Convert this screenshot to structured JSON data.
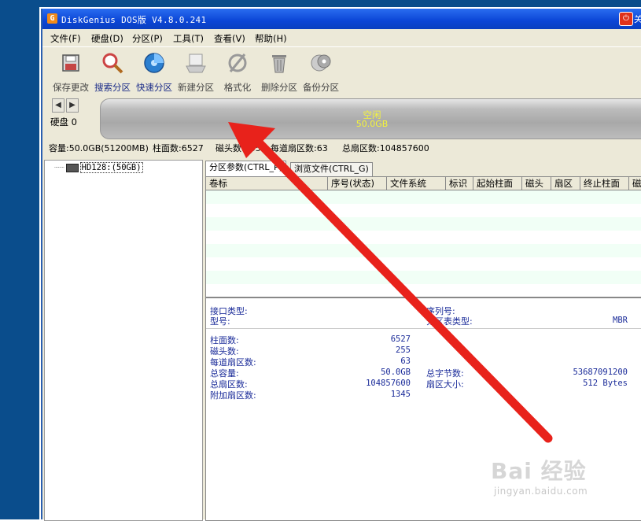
{
  "window": {
    "title": "DiskGenius DOS版 V4.8.0.241",
    "icon_letter": "G",
    "power_glyph": "⏻",
    "extra_char": "关"
  },
  "menu": [
    "文件(F)",
    "硬盘(D)",
    "分区(P)",
    "工具(T)",
    "查看(V)",
    "帮助(H)"
  ],
  "toolbar": [
    {
      "label": "保存更改",
      "icon": "save-disk-icon"
    },
    {
      "label": "搜索分区",
      "icon": "magnifier-icon"
    },
    {
      "label": "快速分区",
      "icon": "quick-partition-disc-icon"
    },
    {
      "label": "新建分区",
      "icon": "new-partition-icon"
    },
    {
      "label": "格式化",
      "icon": "format-icon"
    },
    {
      "label": "删除分区",
      "icon": "trash-icon"
    },
    {
      "label": "备份分区",
      "icon": "backup-disc-icon"
    }
  ],
  "disk": {
    "label": "硬盘 0",
    "prev_glyph": "◀",
    "next_glyph": "▶",
    "partition_name": "空闲",
    "partition_size": "50.0GB"
  },
  "info": {
    "capacity": "容量:50.0GB(51200MB)",
    "cylinders": "柱面数:6527",
    "heads": "磁头数:255",
    "sectors_per_track": "每道扇区数:63",
    "total_sectors": "总扇区数:104857600"
  },
  "tree": {
    "dots": "┈┈",
    "node_label": "HD128:(50GB)"
  },
  "tabs": [
    "分区参数(CTRL_P)",
    "浏览文件(CTRL_G)"
  ],
  "columns": [
    "卷标",
    "序号(状态)",
    "文件系统",
    "标识",
    "起始柱面",
    "磁头",
    "扇区",
    "终止柱面",
    "磁"
  ],
  "details": {
    "interface_type_label": "接口类型:",
    "serial_label": "序列号:",
    "model_label": "型号:",
    "partition_table_label": "分区表类型:",
    "partition_table_value": "MBR",
    "cylinders_label": "柱面数:",
    "cylinders_value": "6527",
    "heads_label": "磁头数:",
    "heads_value": "255",
    "spt_label": "每道扇区数:",
    "spt_value": "63",
    "capacity_label": "总容量:",
    "capacity_value": "50.0GB",
    "total_bytes_label": "总字节数:",
    "total_bytes_value": "53687091200",
    "total_sectors_label": "总扇区数:",
    "total_sectors_value": "104857600",
    "sector_size_label": "扇区大小:",
    "sector_size_value": "512 Bytes",
    "extra_sectors_label": "附加扇区数:",
    "extra_sectors_value": "1345"
  },
  "watermark": {
    "main": "Bai 经验",
    "sub": "jingyan.baidu.com"
  },
  "colors": {
    "arrow": "#e8221b",
    "title_bar": "#0b45d6",
    "value_text": "#1a2b99",
    "partition_text": "#f5f53a"
  }
}
